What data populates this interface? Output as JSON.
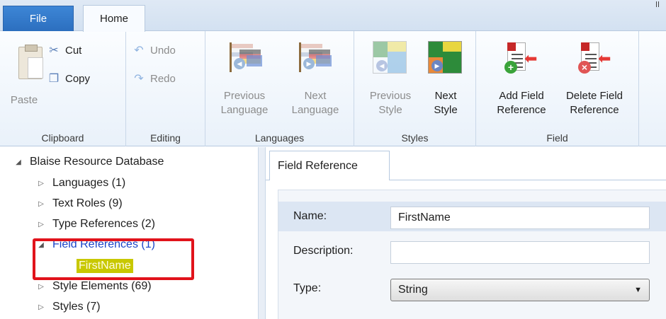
{
  "ribbon": {
    "tabs": [
      {
        "label": "File"
      },
      {
        "label": "Home"
      }
    ],
    "clipboard": {
      "paste": "Paste",
      "cut": "Cut",
      "copy": "Copy",
      "group_label": "Clipboard"
    },
    "editing": {
      "undo": "Undo",
      "redo": "Redo",
      "group_label": "Editing"
    },
    "languages": {
      "previous_line1": "Previous",
      "previous_line2": "Language",
      "next_line1": "Next",
      "next_line2": "Language",
      "group_label": "Languages"
    },
    "styles": {
      "previous_line1": "Previous",
      "previous_line2": "Style",
      "next_line1": "Next",
      "next_line2": "Style",
      "group_label": "Styles"
    },
    "field": {
      "add_line1": "Add Field",
      "add_line2": "Reference",
      "delete_line1": "Delete Field",
      "delete_line2": "Reference",
      "group_label": "Field"
    }
  },
  "tree": {
    "root": "Blaise Resource Database",
    "items": [
      {
        "label": "Languages (1)"
      },
      {
        "label": "Text Roles (9)"
      },
      {
        "label": "Type References (2)"
      },
      {
        "label": "Field References (1)"
      },
      {
        "label": "Style Elements (69)"
      },
      {
        "label": "Styles (7)"
      }
    ],
    "selected_child": "FirstName"
  },
  "detail": {
    "tab": "Field Reference",
    "name_label": "Name:",
    "name_value": "FirstName",
    "description_label": "Description:",
    "description_value": "",
    "type_label": "Type:",
    "type_value": "String"
  },
  "colors": {
    "file_tab": "#2c6fbf",
    "highlight_box": "#e1131b",
    "selected_item_bg": "#c8c800",
    "selected_parent_text": "#1a44c8"
  }
}
